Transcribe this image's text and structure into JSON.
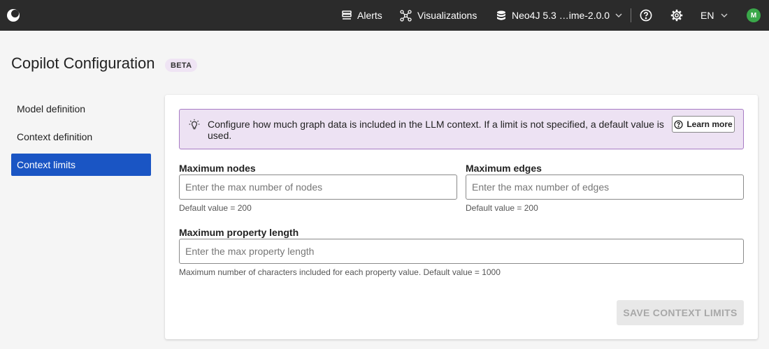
{
  "topbar": {
    "alerts_label": "Alerts",
    "visualizations_label": "Visualizations",
    "datasource_label": "Neo4J 5.3 …ime-2.0.0",
    "language_label": "EN",
    "avatar_initial": "M",
    "avatar_color": "#3aa84a"
  },
  "page": {
    "title": "Copilot Configuration",
    "badge": "BETA"
  },
  "sidebar": {
    "items": [
      {
        "label": "Model definition",
        "active": false
      },
      {
        "label": "Context definition",
        "active": false
      },
      {
        "label": "Context limits",
        "active": true
      }
    ],
    "active_color": "#1a55c4"
  },
  "info": {
    "text": "Configure how much graph data is included in the LLM context. If a limit is not specified, a default value is used.",
    "learn_more_label": "Learn more"
  },
  "form": {
    "max_nodes": {
      "label": "Maximum nodes",
      "value": "",
      "placeholder": "Enter the max number of nodes",
      "helper": "Default value = 200"
    },
    "max_edges": {
      "label": "Maximum edges",
      "value": "",
      "placeholder": "Enter the max number of edges",
      "helper": "Default value = 200"
    },
    "max_property_length": {
      "label": "Maximum property length",
      "value": "",
      "placeholder": "Enter the max property length",
      "helper": "Maximum number of characters included for each property value. Default value = 1000"
    },
    "save_label": "SAVE CONTEXT LIMITS"
  }
}
